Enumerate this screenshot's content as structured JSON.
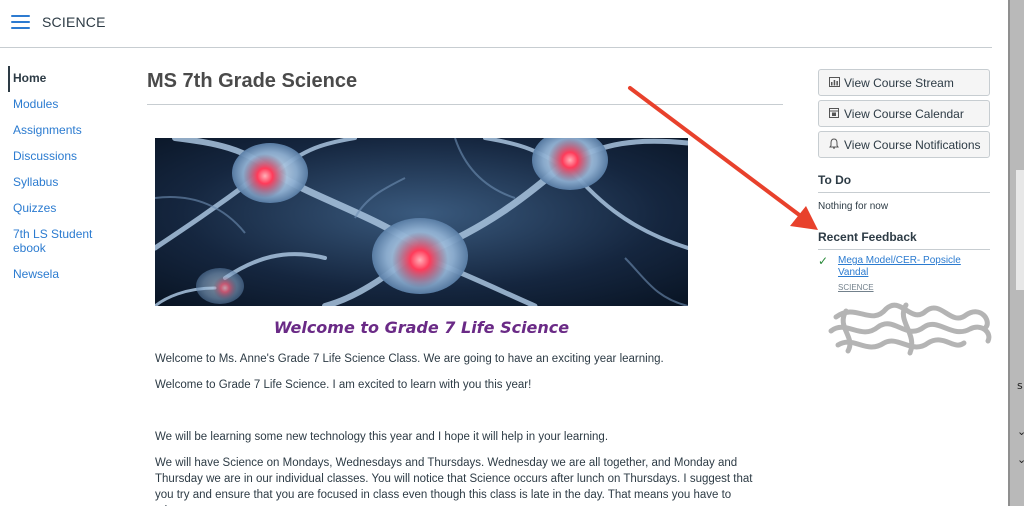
{
  "header": {
    "course_crumb": "SCIENCE"
  },
  "sidebar": {
    "items": [
      {
        "label": "Home",
        "active": true
      },
      {
        "label": "Modules"
      },
      {
        "label": "Assignments"
      },
      {
        "label": "Discussions"
      },
      {
        "label": "Syllabus"
      },
      {
        "label": "Quizzes"
      },
      {
        "label": "7th LS Student ebook"
      },
      {
        "label": "Newsela"
      }
    ]
  },
  "main": {
    "title": "MS 7th Grade Science",
    "welcome_heading": "Welcome to Grade 7 Life Science",
    "paragraphs": [
      "Welcome to Ms. Anne's Grade 7 Life Science Class. We are going to have an exciting year learning.",
      "Welcome to Grade 7 Life Science. I am excited  to learn with you this year!",
      "We will be learning some new technology this year and I hope it will help in your learning.",
      "We will have Science on Mondays, Wednesdays and Thursdays. Wednesday we are all together, and Monday and Thursday we are in our individual classes.  You will notice that Science occurs after lunch  on Thursdays.  I suggest that you try and ensure that you are focused in class even though this class is late in the day. That means you have to take"
    ]
  },
  "right_panel": {
    "buttons": [
      {
        "label": "View Course Stream",
        "icon": "bar-chart-icon"
      },
      {
        "label": "View Course Calendar",
        "icon": "calendar-icon"
      },
      {
        "label": "View Course Notifications",
        "icon": "bell-icon"
      }
    ],
    "todo_heading": "To Do",
    "todo_empty": "Nothing for now",
    "feedback_heading": "Recent Feedback",
    "feedback_item": {
      "title": "Mega Model/CER- Popsicle Vandal",
      "course": "SCIENCE",
      "icon": "check-icon"
    }
  },
  "colors": {
    "link": "#2b7bd0",
    "welcome": "#6a2a86",
    "annotation_arrow": "#e8412c"
  }
}
